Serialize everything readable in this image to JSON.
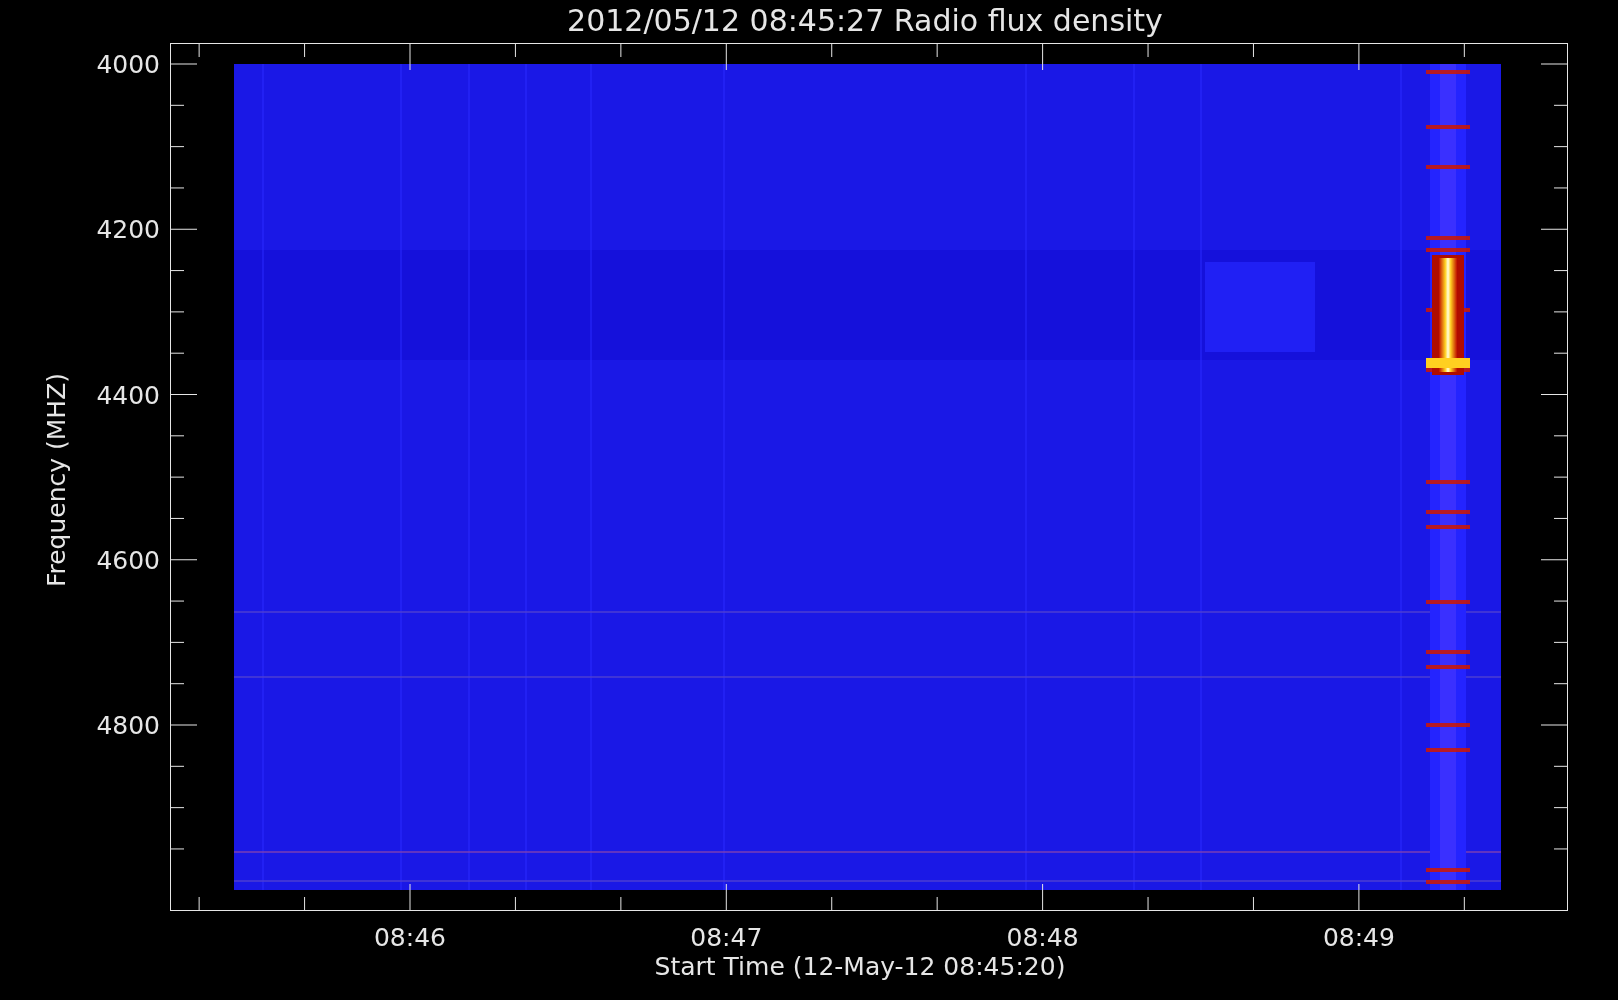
{
  "title": "2012/05/12 08:45:27 Radio flux density",
  "y_axis": {
    "label": "Frequency (MHZ)",
    "ticks": [
      "4000",
      "4200",
      "4400",
      "4600",
      "4800"
    ]
  },
  "x_axis": {
    "label": "Start Time (12-May-12 08:45:20)",
    "ticks": [
      "08:46",
      "08:47",
      "08:48",
      "08:49"
    ]
  }
}
